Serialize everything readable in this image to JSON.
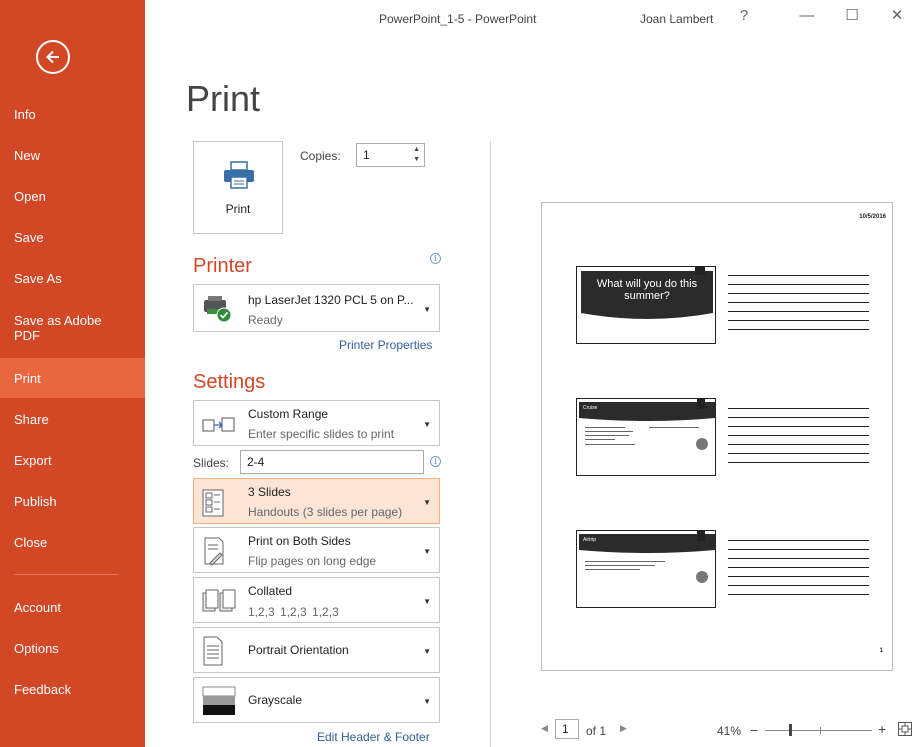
{
  "window": {
    "title": "PowerPoint_1-5 - PowerPoint",
    "user": "Joan Lambert",
    "help": "?",
    "minimize": "—",
    "maximize": "☐",
    "close": "✕"
  },
  "sidebar": {
    "items": [
      {
        "label": "Info"
      },
      {
        "label": "New"
      },
      {
        "label": "Open"
      },
      {
        "label": "Save"
      },
      {
        "label": "Save As"
      },
      {
        "label": "Save as Adobe PDF"
      },
      {
        "label": "Print",
        "active": true
      },
      {
        "label": "Share"
      },
      {
        "label": "Export"
      },
      {
        "label": "Publish"
      },
      {
        "label": "Close"
      },
      {
        "label": "Account"
      },
      {
        "label": "Options"
      },
      {
        "label": "Feedback"
      }
    ]
  },
  "print": {
    "title": "Print",
    "button_label": "Print",
    "copies_label": "Copies:",
    "copies_value": "1"
  },
  "printer": {
    "heading": "Printer",
    "name": "hp LaserJet 1320 PCL 5 on P...",
    "status": "Ready",
    "properties_link": "Printer Properties"
  },
  "settings": {
    "heading": "Settings",
    "range": {
      "title": "Custom Range",
      "desc": "Enter specific slides to print"
    },
    "slides_label": "Slides:",
    "slides_value": "2-4",
    "layout": {
      "title": "3 Slides",
      "desc": "Handouts (3 slides per page)"
    },
    "sides": {
      "title": "Print on Both Sides",
      "desc": "Flip pages on long edge"
    },
    "collation": {
      "title": "Collated",
      "desc": "1,2,3   1,2,3   1,2,3"
    },
    "orientation": {
      "title": "Portrait Orientation"
    },
    "color": {
      "title": "Grayscale"
    },
    "header_footer_link": "Edit Header & Footer"
  },
  "preview": {
    "date": "10/5/2016",
    "page_number": "1",
    "slides": [
      {
        "title": "What will you do this summer?"
      },
      {
        "title": "Cruise"
      },
      {
        "title": "Airtrip"
      }
    ],
    "nav": {
      "current_page": "1",
      "of_label": "of 1"
    },
    "zoom": "41%"
  },
  "colors": {
    "accent": "#d24726",
    "accent_light": "#e9663f",
    "link": "#2e5f99"
  }
}
